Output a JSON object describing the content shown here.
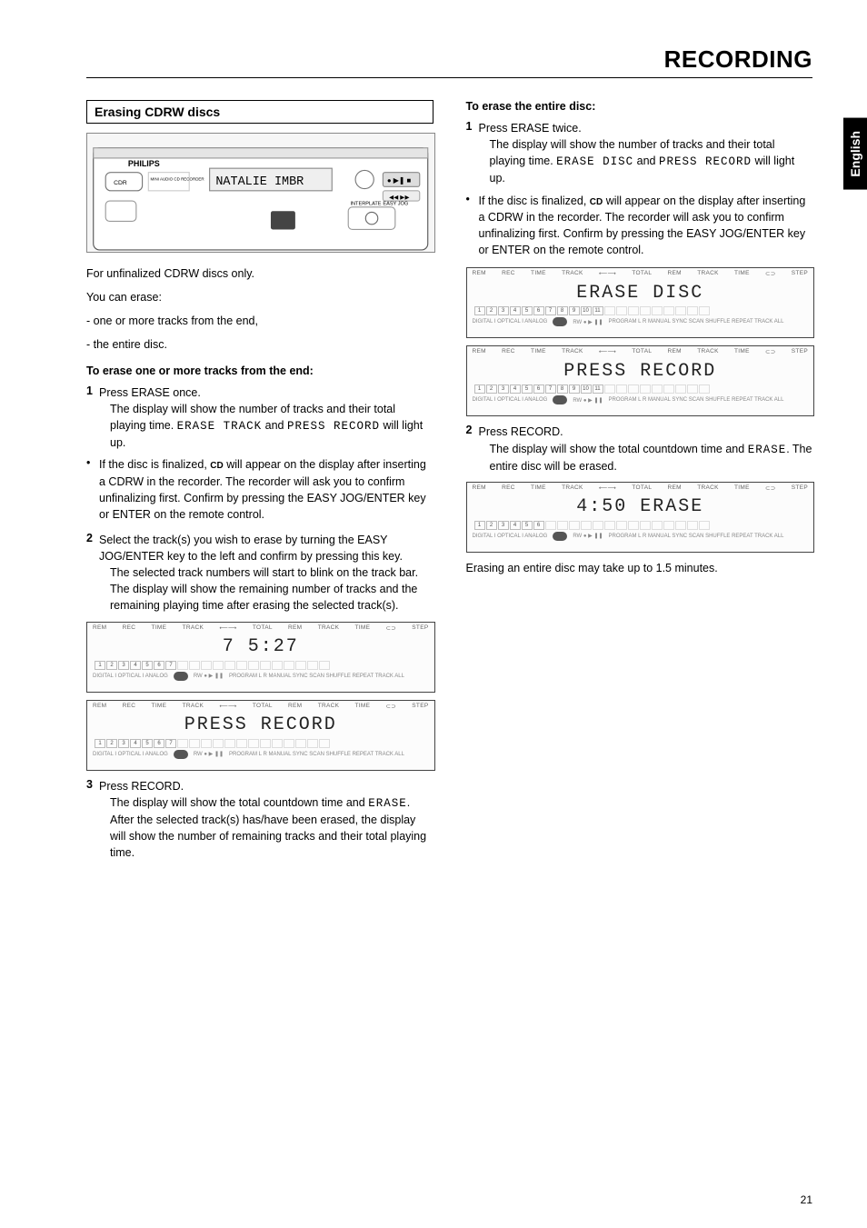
{
  "header": {
    "title": "RECORDING"
  },
  "sideTab": "English",
  "pageNumber": "21",
  "left": {
    "sectionTitle": "Erasing CDRW discs",
    "deviceLabel": "PHILIPS",
    "deviceSub1": "CDR",
    "deviceSub2": "MINI AUDIO CD RECORDER",
    "deviceScreen": "NATALIE  IMBR",
    "intro1": "For unfinalized CDRW discs only.",
    "intro2": "You can erase:",
    "intro3": "- one or more tracks from the end,",
    "intro4": "- the entire disc.",
    "sub1": "To erase one or more tracks from the end:",
    "s1": {
      "n": "1",
      "a": "Press ERASE once.",
      "b": "The display will show the number of tracks and their total playing time. ",
      "lcd1": "ERASE TRACK",
      "mid": " and ",
      "lcd2": "PRESS RECORD",
      "c": " will light up."
    },
    "bullet1": {
      "a": "If the disc is finalized, ",
      "cd": "CD",
      "b": " will appear on the display after inserting a CDRW in the recorder. The recorder will ask you to confirm unfinalizing first. Confirm by pressing the EASY JOG/ENTER key or ENTER on the remote control."
    },
    "s2": {
      "n": "2",
      "a": "Select the track(s) you wish to erase by turning the EASY JOG/ENTER key to the left and confirm by pressing this key.",
      "b": "The selected track numbers will start to blink on the track bar.",
      "c": "The display will show the remaining number of tracks and the remaining playing time after erasing the selected track(s)."
    },
    "disp1": {
      "top": [
        "REM",
        "REC",
        "TIME",
        "TRACK",
        "⟵⟶",
        "TOTAL",
        "REM",
        "TRACK",
        "TIME",
        "⊂⊃",
        "STEP"
      ],
      "main": "  7            5:27",
      "tracks": 7,
      "bottom": [
        "DIGITAL I",
        "OPTICAL I",
        "ANALOG",
        "",
        "PROGRAM",
        "L",
        "R",
        "MANUAL",
        "SYNC",
        "SCAN",
        "SHUFFLE",
        "REPEAT",
        "TRACK",
        "ALL"
      ],
      "icons": "RW ● ▶ ❚❚"
    },
    "disp2": {
      "top": [
        "REM",
        "REC",
        "TIME",
        "TRACK",
        "⟵⟶",
        "TOTAL",
        "REM",
        "TRACK",
        "TIME",
        "⊂⊃",
        "STEP"
      ],
      "main": "PRESS   RECORD",
      "tracks": 7,
      "bottom": [
        "DIGITAL I",
        "OPTICAL I",
        "ANALOG",
        "",
        "PROGRAM",
        "L",
        "R",
        "MANUAL",
        "SYNC",
        "SCAN",
        "SHUFFLE",
        "REPEAT",
        "TRACK",
        "ALL"
      ],
      "icons": "RW ● ▶ ❚❚"
    },
    "s3": {
      "n": "3",
      "a": "Press RECORD.",
      "b": "The display will show the total countdown time and ",
      "lcd1": "ERASE",
      "c": ".",
      "d": "After the selected track(s) has/have been erased, the display will show the number of remaining tracks and their total playing time."
    }
  },
  "right": {
    "sub1": "To erase the entire disc:",
    "s1": {
      "n": "1",
      "a": "Press ERASE twice.",
      "b": "The display will show the number of tracks and their total playing time. ",
      "lcd1": "ERASE DISC",
      "mid": " and ",
      "lcd2": "PRESS RECORD",
      "c": " will light up."
    },
    "bullet1": {
      "a": "If the disc is finalized, ",
      "cd": "CD",
      "b": " will appear on the display after inserting a CDRW in the recorder. The recorder will ask you to confirm unfinalizing first. Confirm by pressing the EASY JOG/ENTER key or ENTER on the remote control."
    },
    "disp1": {
      "top": [
        "REM",
        "REC",
        "TIME",
        "TRACK",
        "⟵⟶",
        "TOTAL",
        "REM",
        "TRACK",
        "TIME",
        "⊂⊃",
        "STEP"
      ],
      "main": "ERASE    DISC",
      "tracks": 11,
      "bottom": [
        "DIGITAL I",
        "OPTICAL I",
        "ANALOG",
        "",
        "PROGRAM",
        "L",
        "R",
        "MANUAL",
        "SYNC",
        "SCAN",
        "SHUFFLE",
        "REPEAT",
        "TRACK",
        "ALL"
      ],
      "icons": "RW ● ▶ ❚❚"
    },
    "disp2": {
      "top": [
        "REM",
        "REC",
        "TIME",
        "TRACK",
        "⟵⟶",
        "TOTAL",
        "REM",
        "TRACK",
        "TIME",
        "⊂⊃",
        "STEP"
      ],
      "main": "PRESS   RECORD",
      "tracks": 11,
      "bottom": [
        "DIGITAL I",
        "OPTICAL I",
        "ANALOG",
        "",
        "PROGRAM",
        "L",
        "R",
        "MANUAL",
        "SYNC",
        "SCAN",
        "SHUFFLE",
        "REPEAT",
        "TRACK",
        "ALL"
      ],
      "icons": "RW ● ▶ ❚❚"
    },
    "s2": {
      "n": "2",
      "a": "Press RECORD.",
      "b": "The display will show the total countdown time and ",
      "lcd1": "ERASE",
      "c": ". The entire disc will be erased."
    },
    "disp3": {
      "top": [
        "REM",
        "REC",
        "TIME",
        "TRACK",
        "⟵⟶",
        "TOTAL",
        "REM",
        "TRACK",
        "TIME",
        "⊂⊃",
        "STEP"
      ],
      "main": " 4:50    ERASE",
      "tracks": 6,
      "bottom": [
        "DIGITAL I",
        "OPTICAL I",
        "ANALOG",
        "",
        "PROGRAM",
        "L",
        "R",
        "MANUAL",
        "SYNC",
        "SCAN",
        "SHUFFLE",
        "REPEAT",
        "TRACK",
        "ALL"
      ],
      "icons": "RW ● ▶ ❚❚"
    },
    "outro": "Erasing an entire disc may take up to 1.5 minutes."
  }
}
